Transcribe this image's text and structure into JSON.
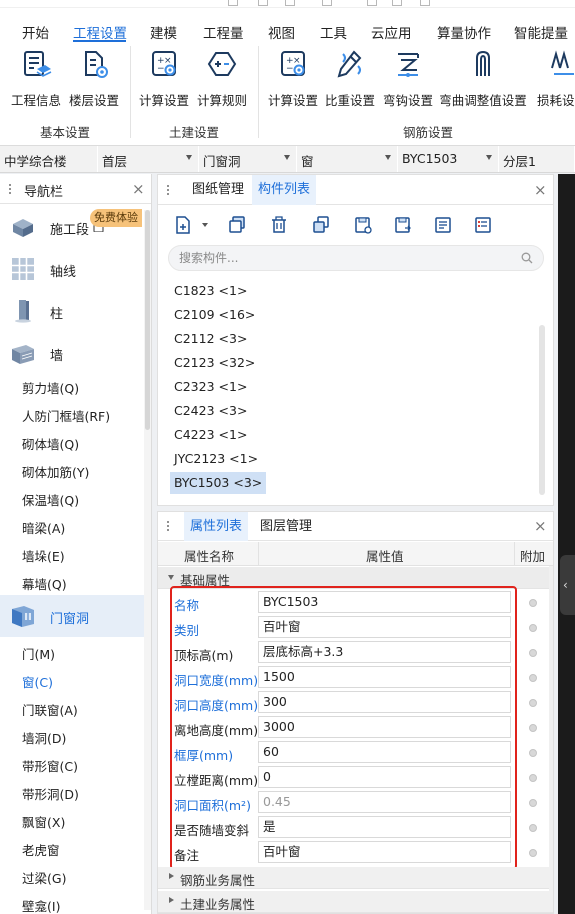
{
  "menu": {
    "tabs": [
      {
        "label": "开始"
      },
      {
        "label": "工程设置",
        "active": true
      },
      {
        "label": "建模"
      },
      {
        "label": "工程量"
      },
      {
        "label": "视图"
      },
      {
        "label": "工具"
      },
      {
        "label": "云应用"
      },
      {
        "label": "算量协作"
      },
      {
        "label": "智能提量"
      }
    ]
  },
  "ribbon": {
    "buttons": [
      {
        "label": "工程信息",
        "icon": "project-info-icon"
      },
      {
        "label": "楼层设置",
        "icon": "floor-settings-icon"
      },
      {
        "label": "计算设置",
        "icon": "calc-settings-icon"
      },
      {
        "label": "计算规则",
        "icon": "calc-rules-icon"
      },
      {
        "label": "计算设置",
        "icon": "rebar-calc-settings-icon"
      },
      {
        "label": "比重设置",
        "icon": "density-settings-icon"
      },
      {
        "label": "弯钩设置",
        "icon": "hook-settings-icon"
      },
      {
        "label": "弯曲调整值设置",
        "icon": "bend-adjust-icon"
      },
      {
        "label": "损耗设置",
        "icon": "loss-settings-icon"
      }
    ],
    "groups": [
      {
        "label": "基本设置"
      },
      {
        "label": "土建设置"
      },
      {
        "label": "钢筋设置"
      }
    ]
  },
  "selectors": [
    {
      "value": "中学综合楼"
    },
    {
      "value": "首层"
    },
    {
      "value": "门窗洞"
    },
    {
      "value": "窗"
    },
    {
      "value": "BYC1503"
    },
    {
      "value": "分层1"
    }
  ],
  "nav": {
    "title": "导航栏",
    "badge": "免费体验",
    "categories": [
      {
        "label": "施工段",
        "icon": "construction-section-icon"
      },
      {
        "label": "轴线",
        "icon": "axis-grid-icon"
      },
      {
        "label": "柱",
        "icon": "column-icon"
      },
      {
        "label": "墙",
        "icon": "wall-icon"
      },
      {
        "label": "门窗洞",
        "icon": "door-window-icon",
        "active": true
      }
    ],
    "wall_items": [
      {
        "label": "剪力墙(Q)"
      },
      {
        "label": "人防门框墙(RF)"
      },
      {
        "label": "砌体墙(Q)"
      },
      {
        "label": "砌体加筋(Y)"
      },
      {
        "label": "保温墙(Q)"
      },
      {
        "label": "暗梁(A)"
      },
      {
        "label": "墙垛(E)"
      },
      {
        "label": "幕墙(Q)"
      }
    ],
    "opening_items": [
      {
        "label": "门(M)"
      },
      {
        "label": "窗(C)",
        "active": true
      },
      {
        "label": "门联窗(A)"
      },
      {
        "label": "墙洞(D)"
      },
      {
        "label": "带形窗(C)"
      },
      {
        "label": "带形洞(D)"
      },
      {
        "label": "飘窗(X)"
      },
      {
        "label": "老虎窗"
      },
      {
        "label": "过梁(G)"
      },
      {
        "label": "壁龛(I)"
      }
    ]
  },
  "component_panel": {
    "tabs": [
      {
        "label": "图纸管理"
      },
      {
        "label": "构件列表",
        "active": true
      }
    ],
    "search_placeholder": "搜索构件...",
    "items": [
      {
        "label": "C1823 <1>"
      },
      {
        "label": "C2109 <16>"
      },
      {
        "label": "C2112 <3>"
      },
      {
        "label": "C2123 <32>"
      },
      {
        "label": "C2323 <1>"
      },
      {
        "label": "C2423 <3>"
      },
      {
        "label": "C4223 <1>"
      },
      {
        "label": "JYC2123 <1>"
      },
      {
        "label": "BYC1503 <3>",
        "selected": true
      }
    ]
  },
  "property_panel": {
    "tabs": [
      {
        "label": "属性列表",
        "active": true
      },
      {
        "label": "图层管理"
      }
    ],
    "columns": {
      "name": "属性名称",
      "value": "属性值",
      "extra": "附加"
    },
    "sections": {
      "basic": "基础属性",
      "rebar": "钢筋业务属性",
      "civil": "土建业务属性"
    },
    "rows": [
      {
        "name": "名称",
        "value": "BYC1503",
        "name_blue": true
      },
      {
        "name": "类别",
        "value": "百叶窗",
        "name_blue": true
      },
      {
        "name": "顶标高(m)",
        "value": "层底标高+3.3"
      },
      {
        "name": "洞口宽度(mm)",
        "value": "1500",
        "name_blue": true
      },
      {
        "name": "洞口高度(mm)",
        "value": "300",
        "name_blue": true
      },
      {
        "name": "离地高度(mm)",
        "value": "3000"
      },
      {
        "name": "框厚(mm)",
        "value": "60",
        "name_blue": true
      },
      {
        "name": "立樘距离(mm)",
        "value": "0"
      },
      {
        "name": "洞口面积(m²)",
        "value": "0.45",
        "name_blue": true,
        "value_gray": true
      },
      {
        "name": "是否随墙变斜",
        "value": "是"
      },
      {
        "name": "备注",
        "value": "百叶窗"
      }
    ]
  }
}
